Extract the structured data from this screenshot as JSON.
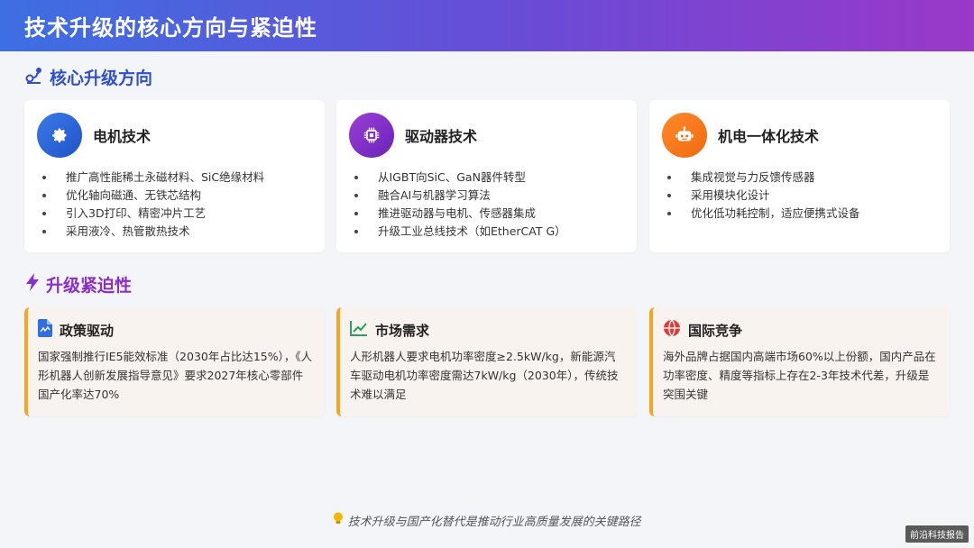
{
  "header": {
    "title": "技术升级的核心方向与紧迫性"
  },
  "section_core": {
    "title": "核心升级方向",
    "icon": "route-icon",
    "color": "#2f4fd0"
  },
  "tech_cards": [
    {
      "name": "电机技术",
      "icon": "gear-icon",
      "bullets": [
        "推广高性能稀土永磁材料、SiC绝缘材料",
        "优化轴向磁通、无铁芯结构",
        "引入3D打印、精密冲片工艺",
        "采用液冷、热管散热技术"
      ]
    },
    {
      "name": "驱动器技术",
      "icon": "chip-icon",
      "bullets": [
        "从IGBT向SiC、GaN器件转型",
        "融合AI与机器学习算法",
        "推进驱动器与电机、传感器集成",
        "升级工业总线技术（如EtherCAT G）"
      ]
    },
    {
      "name": "机电一体化技术",
      "icon": "robot-icon",
      "bullets": [
        "集成视觉与力反馈传感器",
        "采用模块化设计",
        "优化低功耗控制，适应便携式设备"
      ]
    }
  ],
  "section_urgency": {
    "title": "升级紧迫性",
    "icon": "lightning-icon",
    "color": "#8a2fc9"
  },
  "urgency_cards": [
    {
      "title": "政策驱动",
      "icon": "document-icon",
      "text": "国家强制推行IE5能效标准（2030年占比达15%），《人形机器人创新发展指导意见》要求2027年核心零部件国产化率达70%"
    },
    {
      "title": "市场需求",
      "icon": "trend-chart-icon",
      "text": "人形机器人要求电机功率密度≥2.5kW/kg，新能源汽车驱动电机功率密度需达7kW/kg（2030年），传统技术难以满足"
    },
    {
      "title": "国际竞争",
      "icon": "globe-icon",
      "text": "海外品牌占据国内高端市场60%以上份额，国内产品在功率密度、精度等指标上存在2-3年技术代差，升级是突围关键"
    }
  ],
  "footer": {
    "note": "技术升级与国产化替代是推动行业高质量发展的关键路径",
    "icon": "lightbulb-icon"
  },
  "watermark": {
    "text": "前沿科技报告"
  },
  "colors": {
    "accent_orange": "#f5a623",
    "header_start": "#3d6fe2",
    "header_end": "#9a38c8"
  }
}
